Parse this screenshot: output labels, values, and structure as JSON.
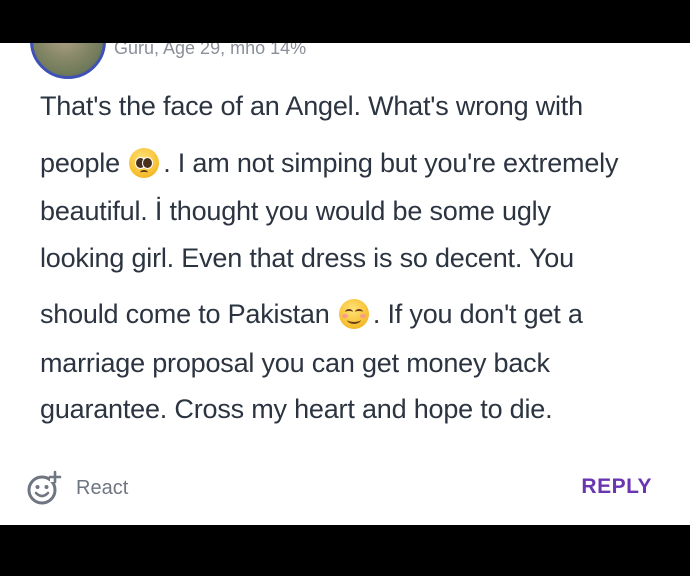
{
  "comment": {
    "meta": "Guru, Age 29, mho 14%",
    "lines": [
      "That's the face of an Angel. What's wrong with",
      "people",
      ". I am not simping but you're extremely",
      "beautiful. İ thought you would be some ugly",
      "looking girl. Even that dress is so decent. You",
      "should come to Pakistan",
      ". If you don't get a",
      "marriage proposal you can get money back",
      "guarantee. Cross my heart and hope to die."
    ],
    "emojis": [
      "pleading-face-emoji",
      "smiling-face-emoji"
    ]
  },
  "actions": {
    "react_label": "React",
    "reply_label": "REPLY",
    "icon": "add-reaction-icon"
  },
  "colors": {
    "reply_accent": "#6a35b0",
    "avatar_ring": "#3f51b5"
  }
}
